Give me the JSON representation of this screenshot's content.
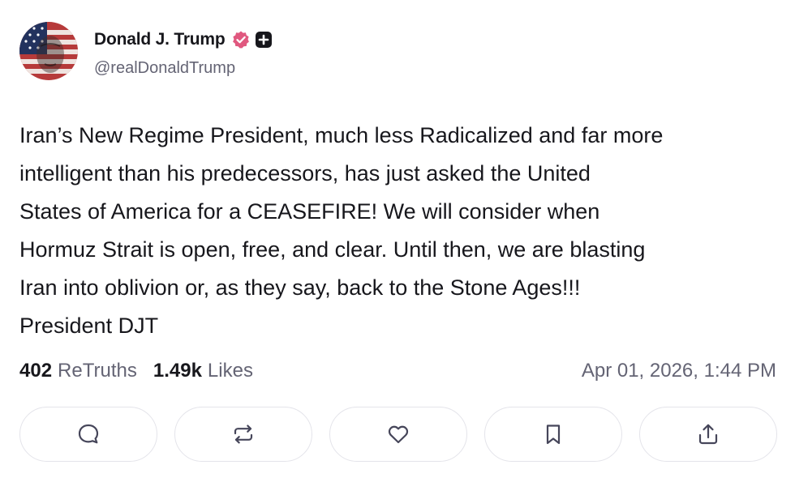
{
  "author": {
    "display_name": "Donald J. Trump",
    "handle": "@realDonaldTrump",
    "verified": true,
    "avatar_icon": "flag-portrait-avatar",
    "badge_icons": [
      "verified-badge-icon",
      "plus-badge-icon"
    ],
    "verified_color": "#e0587f"
  },
  "post": {
    "lines": [
      "Iran’s New Regime President, much less Radicalized and far more",
      "intelligent than his predecessors, has just asked the United",
      "States of America for a CEASEFIRE! We will consider when",
      "Hormuz Strait is open, free, and clear. Until then, we are blasting",
      "Iran into oblivion or, as they say, back to the Stone Ages!!!",
      "President DJT"
    ]
  },
  "stats": {
    "retruths_count": "402",
    "retruths_label": "ReTruths",
    "likes_count": "1.49k",
    "likes_label": "Likes",
    "timestamp": "Apr 01, 2026, 1:44 PM"
  },
  "actions": {
    "icons": [
      "reply-icon",
      "retruth-icon",
      "like-icon",
      "bookmark-icon",
      "share-icon"
    ]
  }
}
